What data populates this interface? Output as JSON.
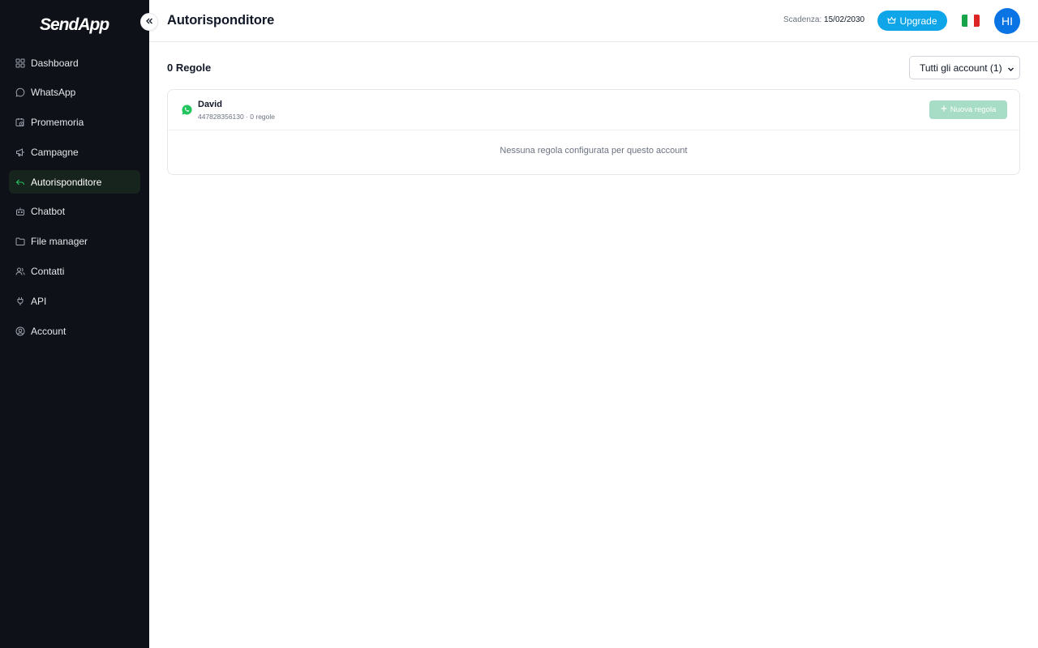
{
  "app": {
    "logo_text": "SendApp"
  },
  "sidebar": {
    "items": [
      {
        "label": "Dashboard",
        "icon": "grid-icon"
      },
      {
        "label": "WhatsApp",
        "icon": "chat-bubble-icon"
      },
      {
        "label": "Promemoria",
        "icon": "calendar-clock-icon"
      },
      {
        "label": "Campagne",
        "icon": "megaphone-icon"
      },
      {
        "label": "Autorisponditore",
        "icon": "reply-arrow-icon",
        "active": true
      },
      {
        "label": "Chatbot",
        "icon": "bot-icon"
      },
      {
        "label": "File manager",
        "icon": "folder-icon"
      },
      {
        "label": "Contatti",
        "icon": "users-icon"
      },
      {
        "label": "API",
        "icon": "plug-icon"
      },
      {
        "label": "Account",
        "icon": "user-circle-icon"
      }
    ]
  },
  "header": {
    "title": "Autorisponditore",
    "expiry_label": "Scadenza:",
    "expiry_date": "15/02/2030",
    "upgrade_label": "Upgrade",
    "avatar_initials": "HI",
    "language_flag": "it-flag-icon"
  },
  "main": {
    "rules_count": "0 Regole",
    "account_filter": {
      "selected": "Tutti gli account (1)"
    },
    "accounts": [
      {
        "name": "David",
        "meta": "447828356130 · 0 regole",
        "new_rule_label": "Nuova regola",
        "empty_message": "Nessuna regola configurata per questo account"
      }
    ]
  },
  "colors": {
    "sidebar_bg": "#0e1117",
    "active_item_bg": "#17241e",
    "accent_green": "#22c55e",
    "upgrade_blue": "#0ea5e9",
    "avatar_blue": "#0b74e5",
    "disabled_green": "#a7dcc7"
  }
}
